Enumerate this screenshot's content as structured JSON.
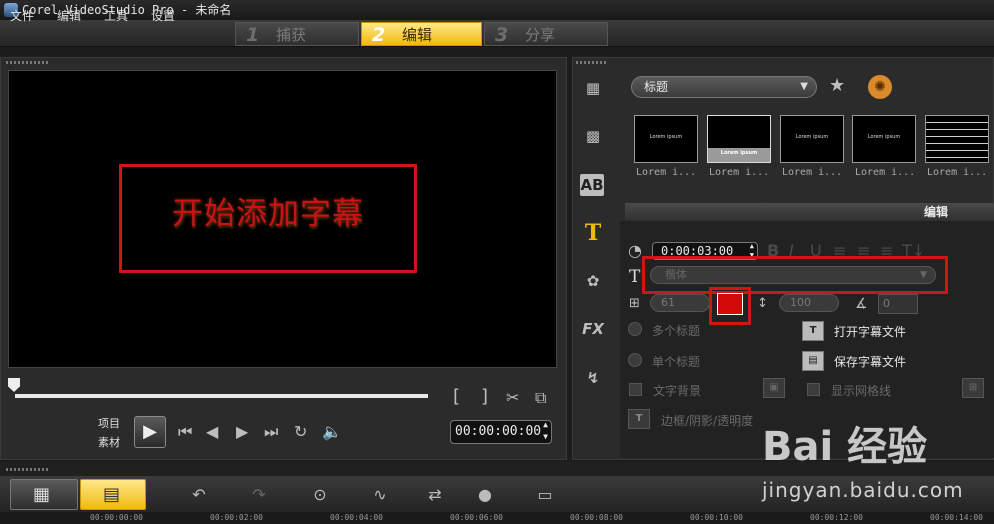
{
  "window": {
    "title": "Corel VideoStudio Pro - 未命名"
  },
  "menu": {
    "items": [
      "文件",
      "编辑",
      "工具",
      "设置"
    ]
  },
  "steps": [
    {
      "num": "1",
      "label": "捕获",
      "active": false
    },
    {
      "num": "2",
      "label": "编辑",
      "active": true
    },
    {
      "num": "3",
      "label": "分享",
      "active": false
    }
  ],
  "preview": {
    "caption": "开始添加字幕",
    "mode_project": "项目",
    "mode_clip": "素材",
    "timecode": "00:00:00:00"
  },
  "library": {
    "category": "标题",
    "thumbnails": [
      {
        "preview": "Lorem ipsum",
        "label": "Lorem i..."
      },
      {
        "preview": "Lorem ipsum",
        "label": "Lorem i..."
      },
      {
        "preview": "Lorem ipsum",
        "label": "Lorem i..."
      },
      {
        "preview": "Lorem ipsum",
        "label": "Lorem i..."
      },
      {
        "preview": "",
        "label": "Lorem i..."
      }
    ],
    "side_icons": [
      "media-icon",
      "transition-icon",
      "title-ab-icon",
      "text-t-icon",
      "graphic-icon",
      "fx-icon",
      "path-icon"
    ],
    "fx_label": "FX",
    "ab_label": "AB"
  },
  "edit_panel": {
    "header": "编辑",
    "duration": "0:00:03:00",
    "font_placeholder": "楷体",
    "font_size": "61",
    "line_spacing": "100",
    "angle": "0",
    "text_color": "#d30a0a",
    "multi_title": "多个标题",
    "single_title": "单个标题",
    "open_subtitle": "打开字幕文件",
    "save_subtitle": "保存字幕文件",
    "text_background": "文字背景",
    "show_grid": "显示网格线",
    "border_shadow": "边框/阴影/透明度"
  },
  "timeline": {
    "ticks": [
      "00:00:00:00",
      "00:00:02:00",
      "00:00:04:00",
      "00:00:06:00",
      "00:00:08:00",
      "00:00:10:00",
      "00:00:12:00",
      "00:00:14:00"
    ]
  },
  "watermark": {
    "brand": "Bai 经验",
    "url": "jingyan.baidu.com"
  }
}
